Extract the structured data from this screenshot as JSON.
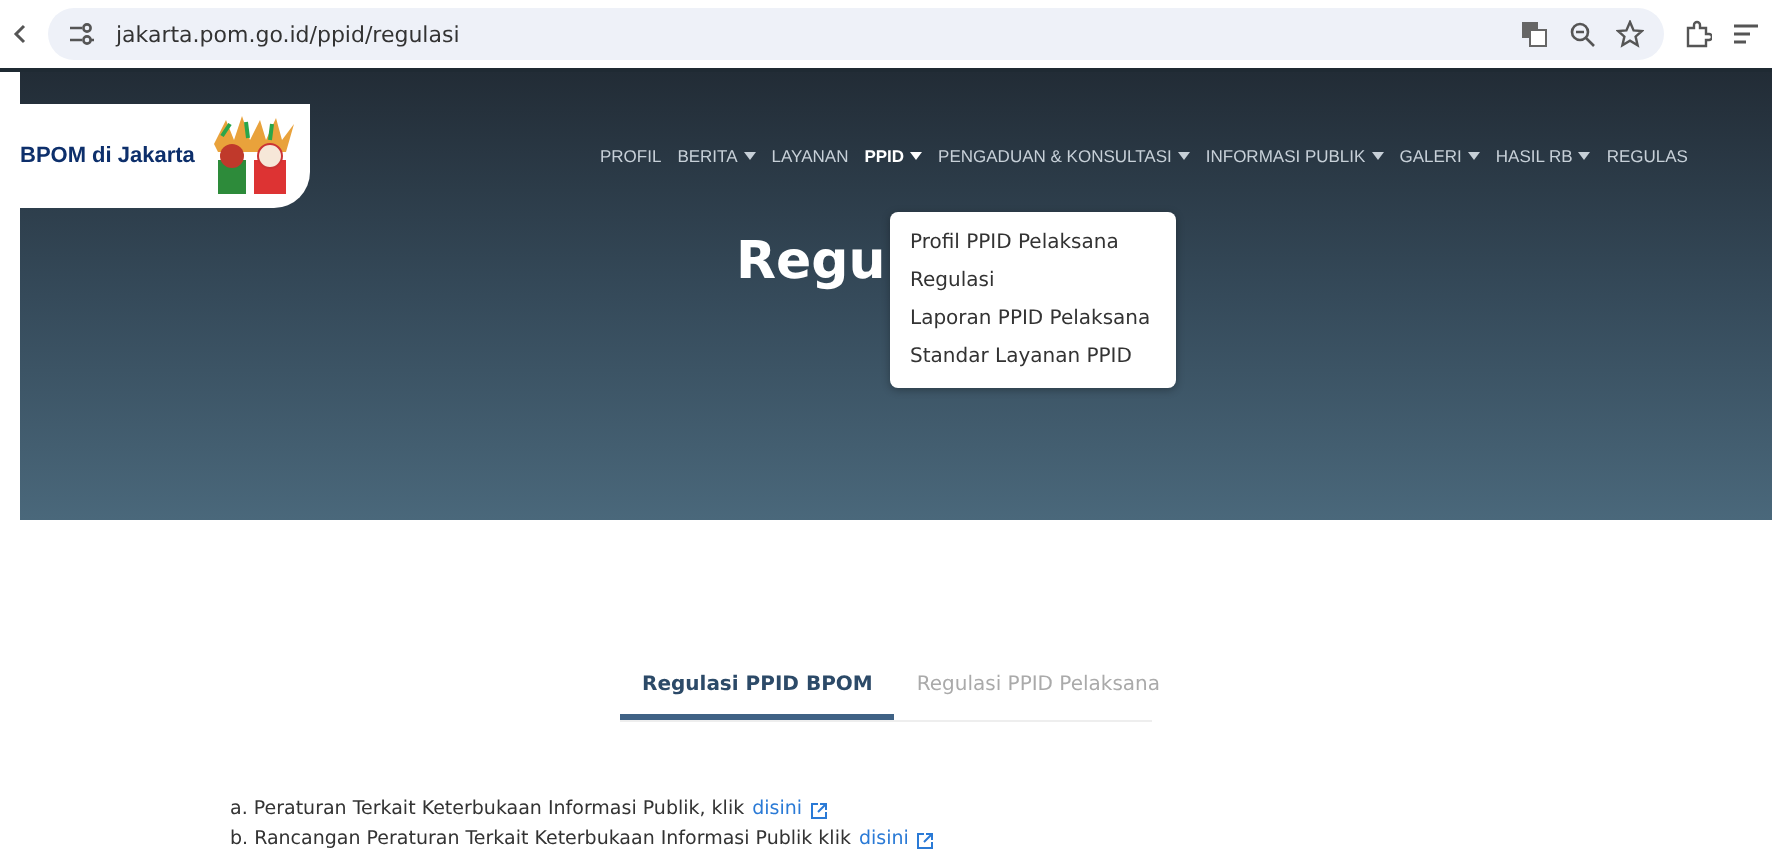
{
  "browser": {
    "url": "jakarta.pom.go.id/ppid/regulasi"
  },
  "header": {
    "logo_text": "BPOM di Jakarta",
    "nav": [
      {
        "label": "PROFIL",
        "dropdown": false,
        "selected": false
      },
      {
        "label": "BERITA",
        "dropdown": true,
        "selected": false
      },
      {
        "label": "LAYANAN",
        "dropdown": false,
        "selected": false
      },
      {
        "label": "PPID",
        "dropdown": true,
        "selected": true
      },
      {
        "label": "PENGADUAN & KONSULTASI",
        "dropdown": true,
        "selected": false
      },
      {
        "label": "INFORMASI PUBLIK",
        "dropdown": true,
        "selected": false
      },
      {
        "label": "GALERI",
        "dropdown": true,
        "selected": false
      },
      {
        "label": "HASIL RB",
        "dropdown": true,
        "selected": false
      },
      {
        "label": "REGULAS",
        "dropdown": false,
        "selected": false
      }
    ],
    "dropdown_menu": [
      "Profil PPID Pelaksana",
      "Regulasi",
      "Laporan PPID Pelaksana",
      "Standar Layanan PPID"
    ]
  },
  "hero": {
    "title": "Regu"
  },
  "tabs": [
    {
      "label": "Regulasi PPID BPOM",
      "selected": true
    },
    {
      "label": "Regulasi PPID Pelaksana",
      "selected": false
    }
  ],
  "items": [
    {
      "text": "a. Peraturan Terkait Keterbukaan Informasi Publik, klik",
      "link": "disini"
    },
    {
      "text": "b. Rancangan Peraturan Terkait Keterbukaan Informasi Publik klik",
      "link": "disini"
    }
  ]
}
